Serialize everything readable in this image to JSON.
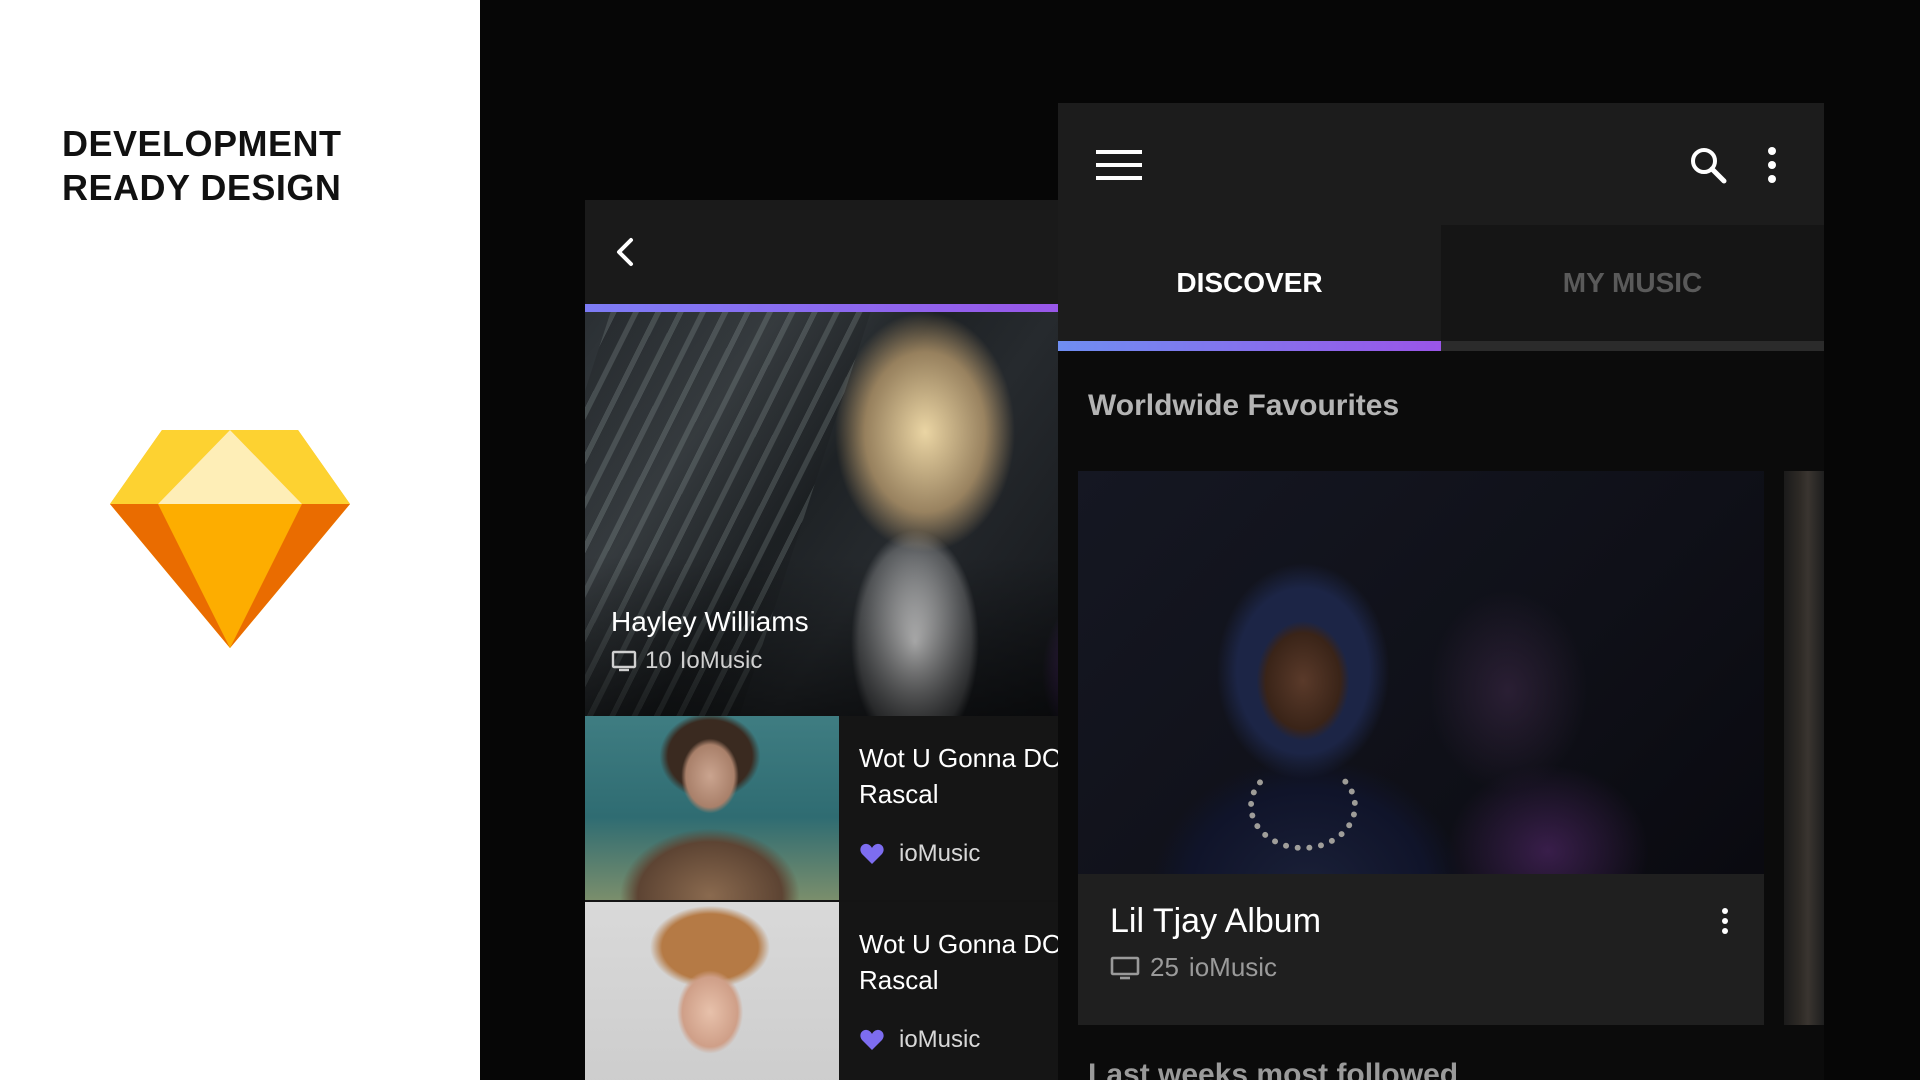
{
  "promo": {
    "title_line1": "DEVELOPMENT",
    "title_line2": "READY DESIGN",
    "logo_icon": "sketch-diamond-icon"
  },
  "colors": {
    "accent_start": "#6f8ef2",
    "accent_end": "#9a55e8",
    "heart": "#7d6df0",
    "background": "#060606"
  },
  "artist_screen": {
    "back_icon": "chevron-left-icon",
    "hero": {
      "name": "Hayley Williams",
      "count": "10",
      "source": "IoMusic",
      "meta_icon": "tv-icon"
    },
    "tracks": [
      {
        "title_line1": "Wot U Gonna DO",
        "title_line2": "Rascal",
        "source": "ioMusic",
        "icon": "heart-icon"
      },
      {
        "title_line1": "Wot U Gonna DO",
        "title_line2": "Rascal",
        "source": "ioMusic",
        "icon": "heart-icon"
      }
    ]
  },
  "discover_screen": {
    "icons": {
      "menu": "hamburger-menu-icon",
      "search": "search-icon",
      "more": "more-vertical-icon"
    },
    "tabs": [
      {
        "label": "DISCOVER",
        "active": true
      },
      {
        "label": "MY MUSIC",
        "active": false
      }
    ],
    "section_title": "Worldwide Favourites",
    "next_section_title": "Last weeks most followed",
    "album": {
      "title": "Lil Tjay Album",
      "count": "25",
      "source": "ioMusic",
      "meta_icon": "tv-icon"
    }
  }
}
